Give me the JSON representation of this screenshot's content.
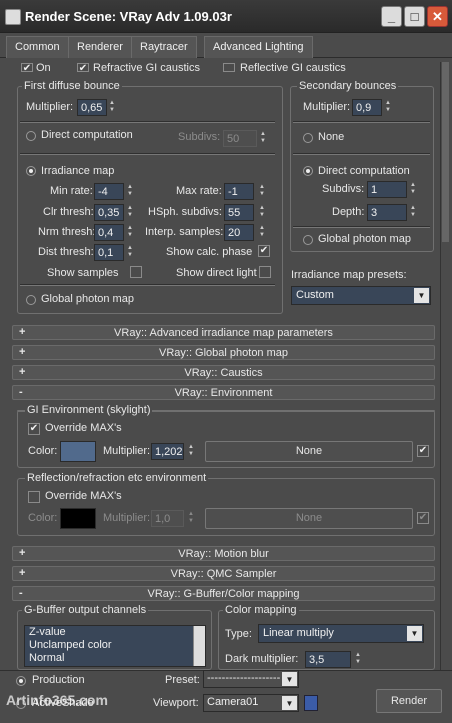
{
  "window": {
    "title": "Render Scene: VRay Adv 1.09.03r",
    "minimize": "_",
    "maximize": "□",
    "close": "✕"
  },
  "tabs": [
    "Common",
    "Renderer",
    "Raytracer",
    "Advanced Lighting"
  ],
  "top_row": {
    "on": "On",
    "refractive": "Refractive GI caustics",
    "reflective": "Reflective GI caustics"
  },
  "first_bounce": {
    "title": "First diffuse bounce",
    "multiplier_label": "Multiplier:",
    "multiplier": "0,65",
    "direct": "Direct computation",
    "subdivs_label": "Subdivs:",
    "subdivs": "50",
    "irradiance": "Irradiance map",
    "min_rate_label": "Min rate:",
    "min_rate": "-4",
    "max_rate_label": "Max rate:",
    "max_rate": "-1",
    "clr_label": "Clr thresh:",
    "clr": "0,35",
    "hsph_label": "HSph. subdivs:",
    "hsph": "55",
    "nrm_label": "Nrm thresh:",
    "nrm": "0,4",
    "interp_label": "Interp. samples:",
    "interp": "20",
    "dist_label": "Dist thresh:",
    "dist": "0,1",
    "show_calc": "Show calc. phase",
    "show_samples": "Show samples",
    "show_direct": "Show direct light",
    "global_photon": "Global photon map"
  },
  "secondary": {
    "title": "Secondary bounces",
    "multiplier_label": "Multiplier:",
    "multiplier": "0,9",
    "none": "None",
    "direct": "Direct computation",
    "subdivs_label": "Subdivs:",
    "subdivs": "1",
    "depth_label": "Depth:",
    "depth": "3",
    "global_photon": "Global photon map"
  },
  "presets": {
    "label": "Irradiance map presets:",
    "value": "Custom"
  },
  "rollouts": {
    "adv_irr": {
      "sign": "+",
      "label": "VRay:: Advanced irradiance map parameters"
    },
    "photon": {
      "sign": "+",
      "label": "VRay:: Global photon map"
    },
    "caustics": {
      "sign": "+",
      "label": "VRay:: Caustics"
    },
    "environment": {
      "sign": "-",
      "label": "VRay:: Environment"
    },
    "motion": {
      "sign": "+",
      "label": "VRay:: Motion blur"
    },
    "qmc": {
      "sign": "+",
      "label": "VRay:: QMC Sampler"
    },
    "gbuffer": {
      "sign": "-",
      "label": "VRay:: G-Buffer/Color mapping"
    }
  },
  "gi_env": {
    "title": "GI Environment (skylight)",
    "override": "Override MAX's",
    "color_label": "Color:",
    "color": "#516a8c",
    "mult_label": "Multiplier:",
    "mult": "1,202",
    "none": "None"
  },
  "refl_env": {
    "title": "Reflection/refraction etc environment",
    "override": "Override MAX's",
    "color_label": "Color:",
    "color": "#000000",
    "mult_label": "Multiplier:",
    "mult": "1,0",
    "none": "None"
  },
  "gbuffer": {
    "title": "G-Buffer output channels",
    "items": [
      "Z-value",
      "Unclamped color",
      "Normal"
    ]
  },
  "color_mapping": {
    "title": "Color mapping",
    "type_label": "Type:",
    "type": "Linear multiply",
    "dark_label": "Dark multiplier:",
    "dark": "3,5"
  },
  "bottom": {
    "production": "Production",
    "activeshade": "ActiveShade",
    "preset_label": "Preset:",
    "preset": "--------------------",
    "viewport_label": "Viewport:",
    "viewport": "Camera01",
    "render": "Render",
    "watermark": "Artinfo365.com"
  }
}
